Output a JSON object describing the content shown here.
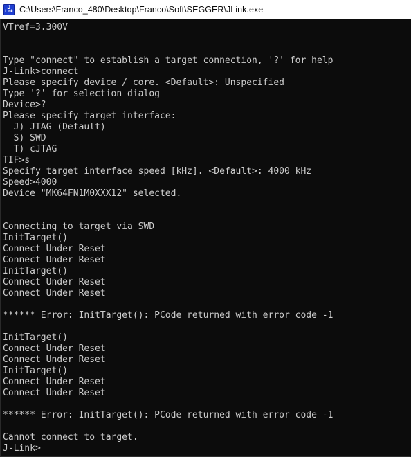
{
  "window": {
    "title": "C:\\Users\\Franco_480\\Desktop\\Franco\\Soft\\SEGGER\\JLink.exe",
    "icon_name": "jlink-app-icon",
    "icon_primary_glyph": "J",
    "icon_secondary_glyph": "Link",
    "background_color": "#0c0c0c",
    "text_color": "#cccccc",
    "titlebar_color": "#ffffff",
    "titlebar_text_color": "#0b0b0b",
    "icon_color": "#1f3fd0"
  },
  "console": {
    "prompt": "J-Link>",
    "lines": [
      "VTref=3.300V",
      "",
      "",
      "Type \"connect\" to establish a target connection, '?' for help",
      "J-Link>connect",
      "Please specify device / core. <Default>: Unspecified",
      "Type '?' for selection dialog",
      "Device>?",
      "Please specify target interface:",
      "  J) JTAG (Default)",
      "  S) SWD",
      "  T) cJTAG",
      "TIF>s",
      "Specify target interface speed [kHz]. <Default>: 4000 kHz",
      "Speed>4000",
      "Device \"MK64FN1M0XXX12\" selected.",
      "",
      "",
      "Connecting to target via SWD",
      "InitTarget()",
      "Connect Under Reset",
      "Connect Under Reset",
      "InitTarget()",
      "Connect Under Reset",
      "Connect Under Reset",
      "",
      "****** Error: InitTarget(): PCode returned with error code -1",
      "",
      "InitTarget()",
      "Connect Under Reset",
      "Connect Under Reset",
      "InitTarget()",
      "Connect Under Reset",
      "Connect Under Reset",
      "",
      "****** Error: InitTarget(): PCode returned with error code -1",
      "",
      "Cannot connect to target.",
      "J-Link>"
    ]
  }
}
